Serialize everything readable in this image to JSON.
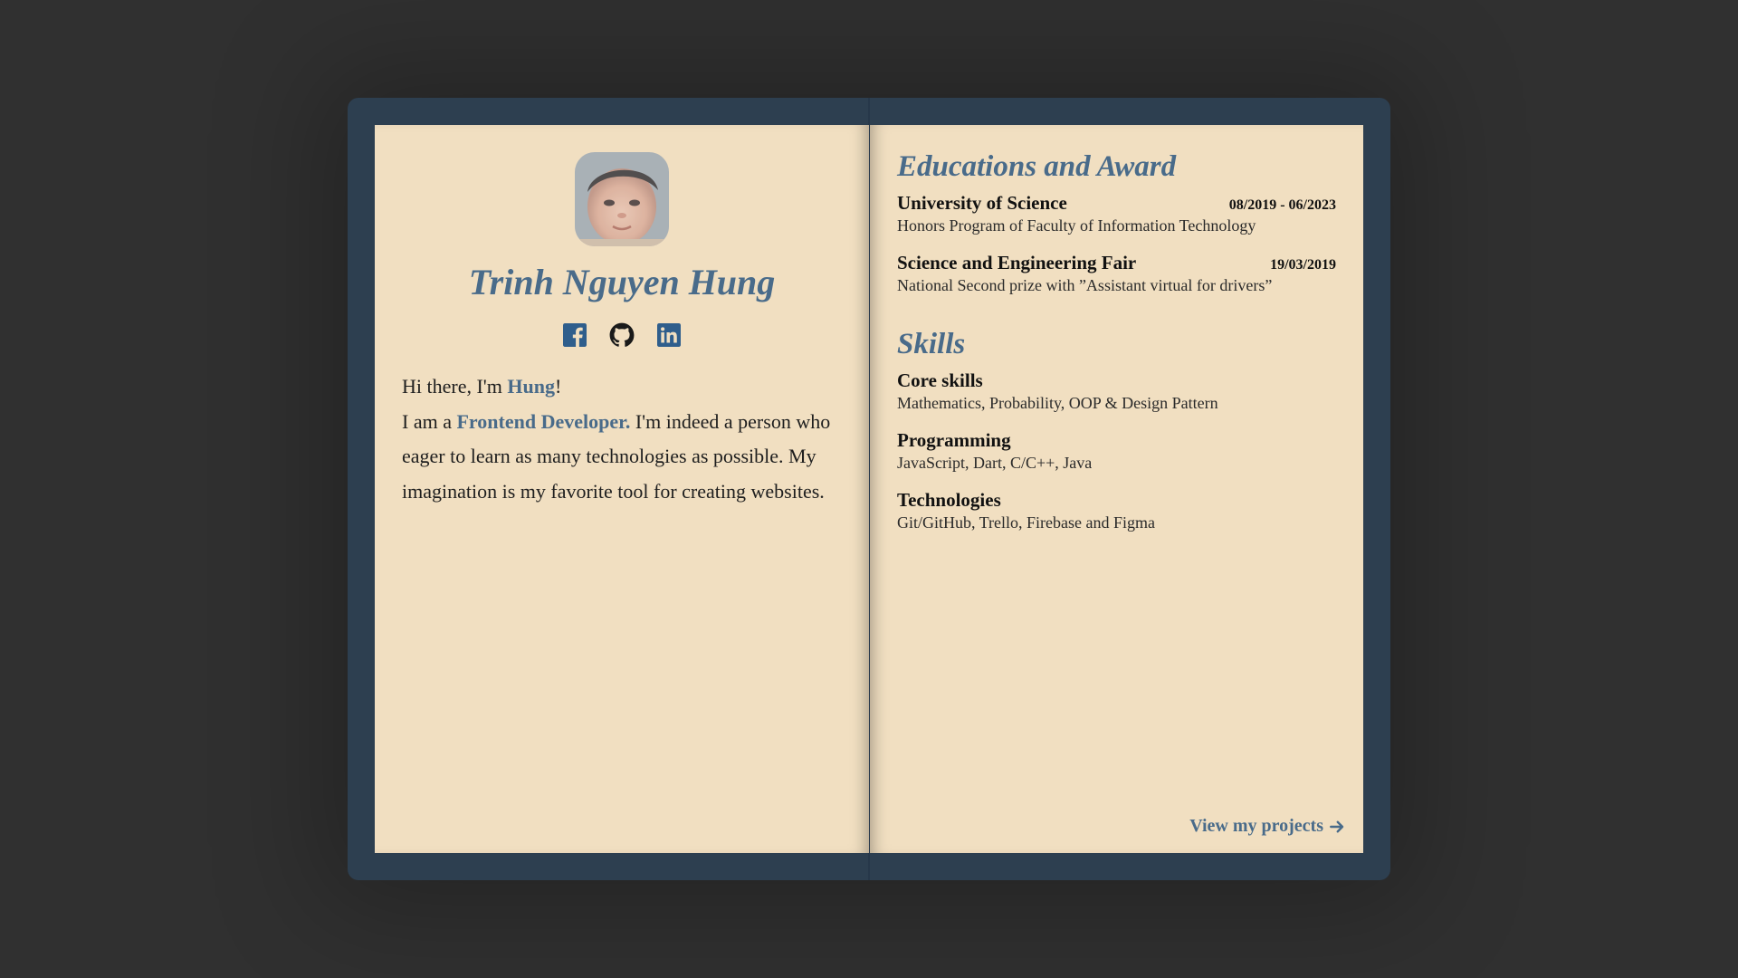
{
  "profile": {
    "name": "Trinh Nguyen Hung",
    "avatar_alt": "profile photo"
  },
  "socials": [
    {
      "icon": "facebook-icon"
    },
    {
      "icon": "github-icon"
    },
    {
      "icon": "linkedin-icon"
    }
  ],
  "intro": {
    "line1_prefix": "Hi there, I'm ",
    "line1_name": "Hung",
    "line1_suffix": "!",
    "line2_prefix": "I am a ",
    "role": "Frontend Developer.",
    "line2_rest": " I'm indeed a person who eager to learn as many technologies as possible. My imagination is my favorite tool for creating websites."
  },
  "education": {
    "title": "Educations and Award",
    "items": [
      {
        "title": "University of Science",
        "date": "08/2019 - 06/2023",
        "desc": "Honors Program of Faculty of Information Technology"
      },
      {
        "title": "Science and Engineering Fair",
        "date": "19/03/2019",
        "desc": "National Second prize with ”Assistant virtual for drivers”"
      }
    ]
  },
  "skills": {
    "title": "Skills",
    "items": [
      {
        "title": "Core skills",
        "desc": "Mathematics, Probability, OOP & Design Pattern"
      },
      {
        "title": "Programming",
        "desc": "JavaScript, Dart, C/C++, Java"
      },
      {
        "title": "Technologies",
        "desc": "Git/GitHub, Trello, Firebase and Figma"
      }
    ]
  },
  "footer": {
    "view_projects": "View my projects"
  },
  "colors": {
    "background": "#303030",
    "book_cover": "#2d3f50",
    "page": "#f1dfc1",
    "accent": "#496b8a",
    "text": "#1e1e1e"
  }
}
